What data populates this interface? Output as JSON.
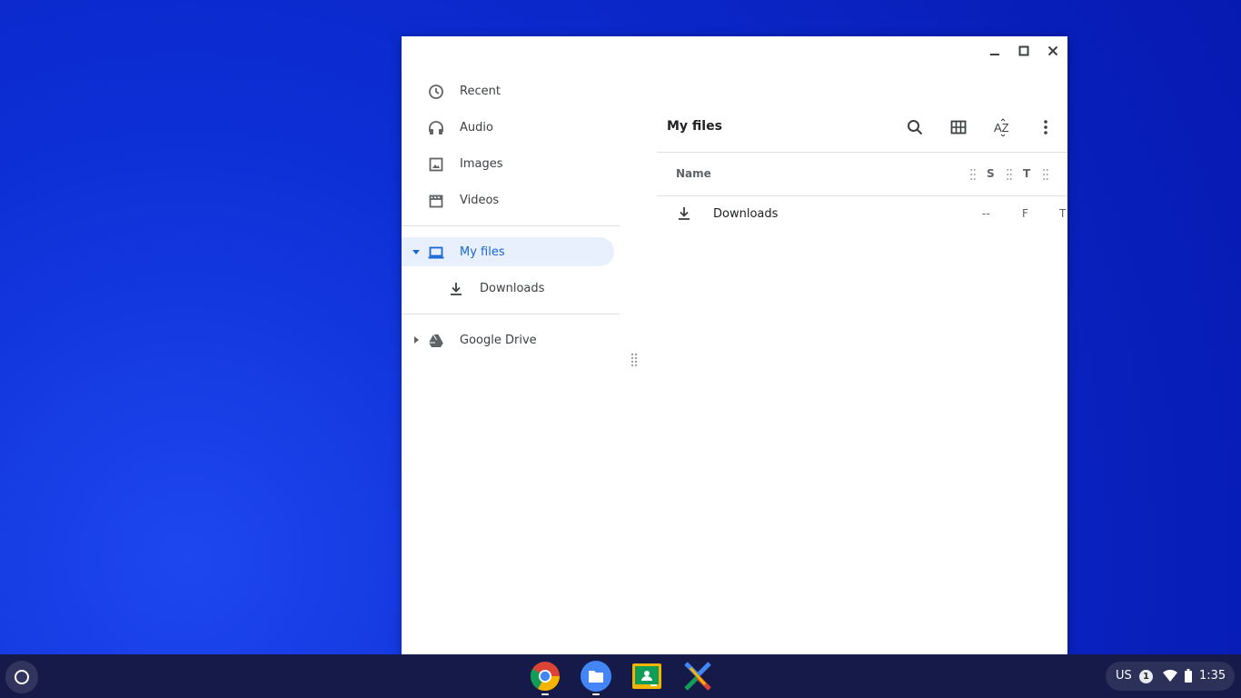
{
  "window": {
    "controls": {
      "minimize": "minimize-icon",
      "maximize": "maximize-icon",
      "close": "close-icon"
    }
  },
  "sidebar": {
    "items": [
      {
        "label": "Recent",
        "icon": "clock-icon"
      },
      {
        "label": "Audio",
        "icon": "headphones-icon"
      },
      {
        "label": "Images",
        "icon": "image-icon"
      },
      {
        "label": "Videos",
        "icon": "film-icon"
      }
    ],
    "my_files": {
      "label": "My files",
      "icon": "laptop-icon",
      "expanded": true
    },
    "downloads": {
      "label": "Downloads",
      "icon": "download-icon"
    },
    "google_drive": {
      "label": "Google Drive",
      "icon": "drive-icon",
      "expanded": false
    }
  },
  "main": {
    "title": "My files",
    "toolbar": [
      "search-icon",
      "grid-view-icon",
      "sort-az-icon",
      "more-vert-icon"
    ],
    "sort_label": "AZ",
    "columns": {
      "name": "Name",
      "size": "S",
      "type": "T"
    },
    "rows": [
      {
        "name": "Downloads",
        "icon": "download-icon",
        "size": "--",
        "type": "F",
        "modified": "T"
      }
    ]
  },
  "shelf": {
    "apps": [
      "chrome-icon",
      "files-icon",
      "classroom-icon",
      "app-x-icon"
    ],
    "tray": {
      "ime": "US",
      "notifications": "1",
      "time": "1:35"
    }
  },
  "colors": {
    "selected_bg": "#e8f0fe",
    "selected_text": "#1967d2",
    "shelf": "#151a48"
  }
}
